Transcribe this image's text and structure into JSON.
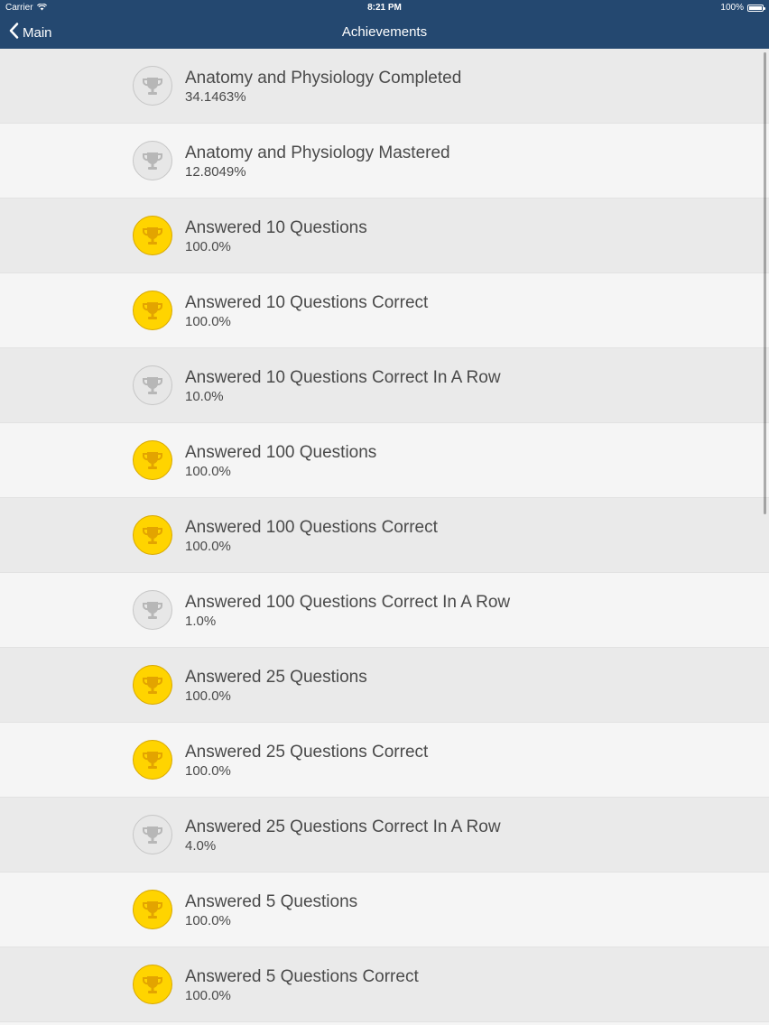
{
  "status": {
    "carrier": "Carrier",
    "time": "8:21 PM",
    "battery": "100%",
    "battery_level": 1.0,
    "icons": [
      "wifi-icon",
      "battery-icon"
    ]
  },
  "nav": {
    "back_label": "Main",
    "back_icon": "chevron-left-icon",
    "title": "Achievements"
  },
  "colors": {
    "nav_bg": "#244870",
    "trophy_earned": "#ffd400",
    "trophy_earned_cup": "#e3a400",
    "trophy_locked": "#e7e7e7",
    "trophy_locked_cup": "#b7b7b7"
  },
  "achievements": [
    {
      "title": "Anatomy and Physiology Completed",
      "percent": "34.1463%",
      "earned": false,
      "icon": "trophy-icon"
    },
    {
      "title": "Anatomy and Physiology Mastered",
      "percent": "12.8049%",
      "earned": false,
      "icon": "trophy-icon"
    },
    {
      "title": "Answered 10 Questions",
      "percent": "100.0%",
      "earned": true,
      "icon": "trophy-icon"
    },
    {
      "title": "Answered 10 Questions Correct",
      "percent": "100.0%",
      "earned": true,
      "icon": "trophy-icon"
    },
    {
      "title": "Answered 10 Questions Correct In A Row",
      "percent": "10.0%",
      "earned": false,
      "icon": "trophy-icon"
    },
    {
      "title": "Answered 100 Questions",
      "percent": "100.0%",
      "earned": true,
      "icon": "trophy-icon"
    },
    {
      "title": "Answered 100 Questions Correct",
      "percent": "100.0%",
      "earned": true,
      "icon": "trophy-icon"
    },
    {
      "title": "Answered 100 Questions Correct In A Row",
      "percent": "1.0%",
      "earned": false,
      "icon": "trophy-icon"
    },
    {
      "title": "Answered 25 Questions",
      "percent": "100.0%",
      "earned": true,
      "icon": "trophy-icon"
    },
    {
      "title": "Answered 25 Questions Correct",
      "percent": "100.0%",
      "earned": true,
      "icon": "trophy-icon"
    },
    {
      "title": "Answered 25 Questions Correct In A Row",
      "percent": "4.0%",
      "earned": false,
      "icon": "trophy-icon"
    },
    {
      "title": "Answered 5 Questions",
      "percent": "100.0%",
      "earned": true,
      "icon": "trophy-icon"
    },
    {
      "title": "Answered 5 Questions Correct",
      "percent": "100.0%",
      "earned": true,
      "icon": "trophy-icon"
    }
  ]
}
